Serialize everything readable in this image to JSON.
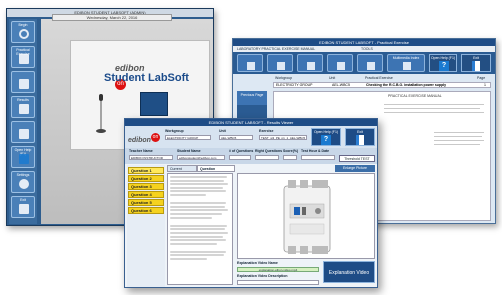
{
  "launcher": {
    "date": "Wednesday, March 22, 2016",
    "title_bar": "EDIBON STUDENT LABSOFT (ADMIN)",
    "logo_brand": "edibon",
    "logo_mark": "on",
    "app_name": "Student LabSoft",
    "sidebar": [
      {
        "label": "Begin"
      },
      {
        "label": "Practical Exercise"
      },
      {
        "label": ""
      },
      {
        "label": "Results"
      },
      {
        "label": ""
      },
      {
        "label": "Open Help (F1)"
      },
      {
        "label": "Settings"
      },
      {
        "label": "Exit"
      }
    ]
  },
  "practical": {
    "title": "EDIBON STUDENT LABSOFT - Practical Exercise",
    "bar": "LABORATORY PRACTICAL EXERCISE MANUAL",
    "bar_right": "TOOLS",
    "toolbar": [
      "",
      "",
      "",
      "",
      "",
      ""
    ],
    "multimedia": "Multimedia Index",
    "help": "Open Help (F1)",
    "exit": "Exit",
    "columns": [
      "Workgroup",
      "Unit",
      "Practical Exercise",
      "Page"
    ],
    "row": {
      "workgroup": "ELECTRICITY GROUP",
      "unit": "AEL-WBC5",
      "exercise": "Checking the R.C.B.O. installation power supply",
      "page": "1"
    },
    "prev_page": "Previous Page",
    "doc_title": "PRACTICAL EXERCISE MANUAL"
  },
  "results": {
    "title": "EDIBON STUDENT LABSOFT - Results Viewer",
    "labels": {
      "workgroup": "Workgroup",
      "unit": "Unit",
      "exercise": "Exercise"
    },
    "values": {
      "workgroup": "ELECTRICITY GROUP",
      "unit": "AEL-WBC5",
      "exercise": "TEST_w3_PE_p1_1_AEL-WBC5"
    },
    "help": "Open Help (F1)",
    "exit": "Exit",
    "info_labels": [
      "Teacher Name",
      "Student Name",
      "# of Questions",
      "Right Questions",
      "Score(%)",
      "Test Hour & Date"
    ],
    "info_values": [
      "EDIBON INSTRUCTOR",
      "edibonstudent@edibon.com",
      "",
      "",
      "",
      ""
    ],
    "threshold_btn": "Threshold TEST",
    "questions": [
      "Question 1",
      "Question 2",
      "Question 3",
      "Question 4",
      "Question 5",
      "Question 6"
    ],
    "tabs": [
      "Current Question",
      "Question Explanation"
    ],
    "extended_tab": "Enlarge Picture",
    "video_name_label": "Explanation Video Name",
    "video_name": "explanation-elbon-video.mp4",
    "video_desc_label": "Explanation Video Description",
    "explanation_video_button": "Explanation Video"
  },
  "colors": {
    "accent": "#1e4c86",
    "question": "#f5d21f",
    "edibon_red": "#dd1111"
  }
}
